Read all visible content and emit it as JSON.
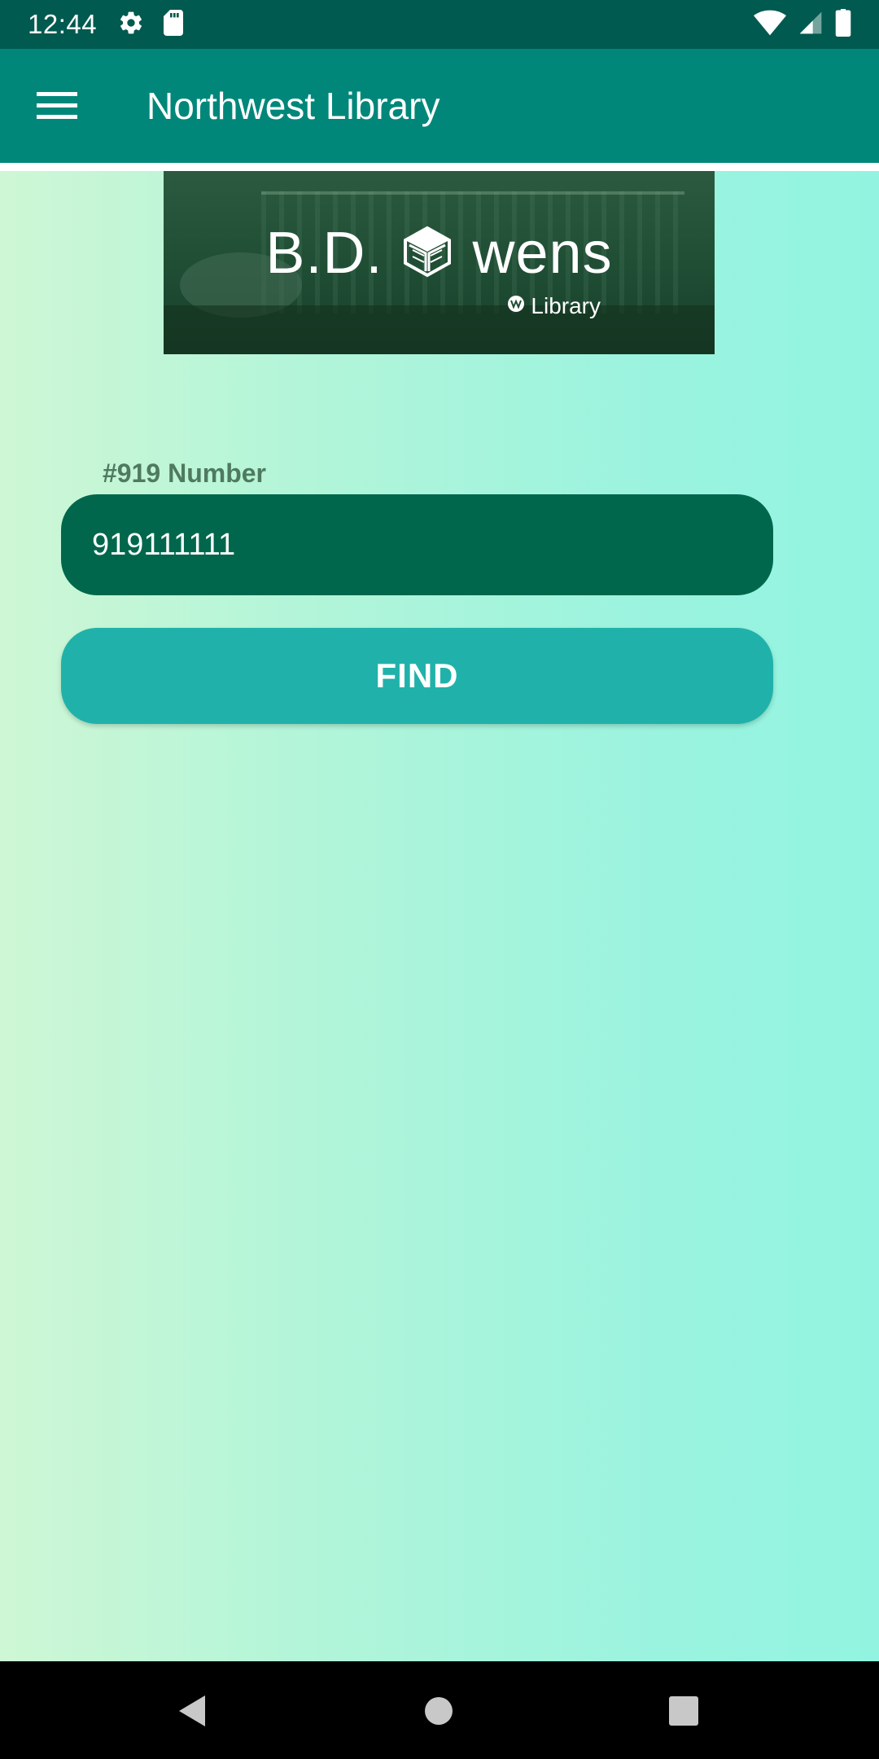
{
  "status_bar": {
    "time": "12:44",
    "icons": [
      "gear-icon",
      "sd-card-icon",
      "wifi-icon",
      "signal-icon",
      "battery-icon"
    ]
  },
  "app_bar": {
    "title": "Northwest Library",
    "menu_icon": "hamburger-menu-icon",
    "background": "#00877a"
  },
  "banner": {
    "title_left": "B.D.",
    "title_right": "wens",
    "subtitle": "Library"
  },
  "form": {
    "label": "#919 Number",
    "input_value": "919111111",
    "button_label": "FIND",
    "button_color": "#20b2aa",
    "input_color": "#00674c"
  },
  "nav_bar": {
    "buttons": [
      "back-icon",
      "home-icon",
      "recents-icon"
    ]
  }
}
